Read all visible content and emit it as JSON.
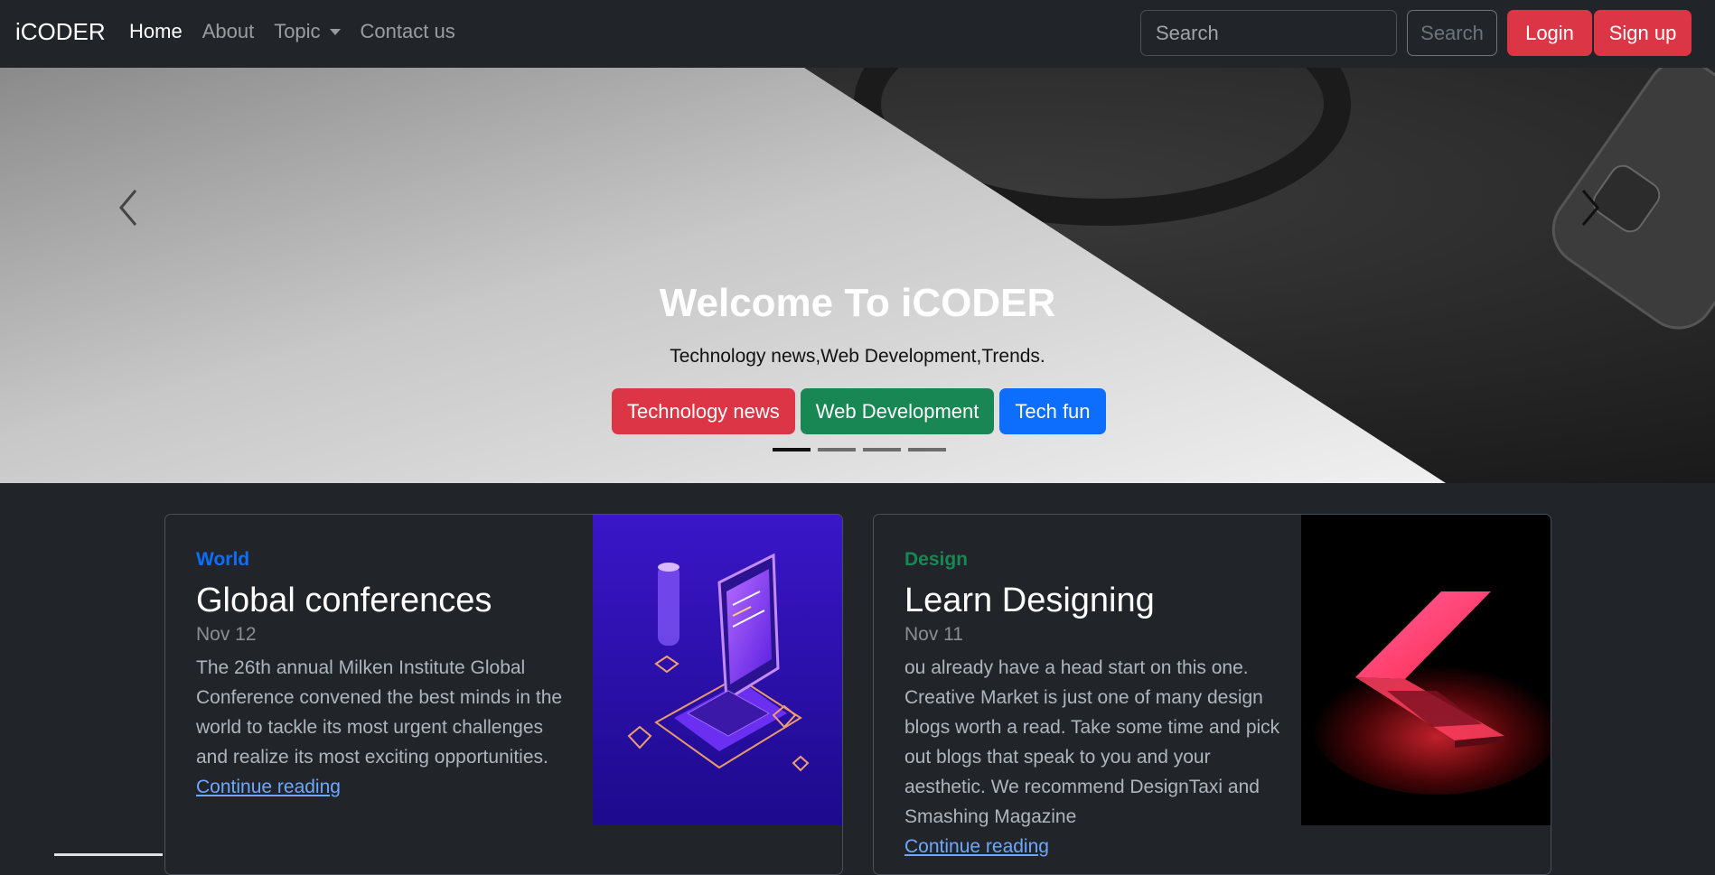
{
  "nav": {
    "brand": "iCODER",
    "links": [
      {
        "label": "Home"
      },
      {
        "label": "About"
      },
      {
        "label": "Topic"
      },
      {
        "label": "Contact us"
      }
    ],
    "search_placeholder": "Search",
    "search_button": "Search",
    "login": "Login",
    "signup": "Sign up"
  },
  "carousel": {
    "title": "Welcome To iCODER",
    "subtitle": "Technology news,Web Development,Trends.",
    "buttons": [
      {
        "label": "Technology news",
        "color": "#dc3545"
      },
      {
        "label": "Web Development",
        "color": "#198754"
      },
      {
        "label": "Tech fun",
        "color": "#0d6efd"
      }
    ],
    "slide_count": 4,
    "active_slide": 1
  },
  "cards": [
    {
      "category": "World",
      "category_color": "#0d6efd",
      "title": "Global conferences",
      "date": "Nov 12",
      "text": "The 26th annual Milken Institute Global Conference convened the best minds in the world to tackle its most urgent challenges and realize its most exciting opportunities.",
      "link": "Continue reading"
    },
    {
      "category": "Design",
      "category_color": "#198754",
      "title": "Learn Designing",
      "date": "Nov 11",
      "text": "ou already have a head start on this one. Creative Market is just one of many design blogs worth a read. Take some time and pick out blogs that speak to you and your aesthetic. We recommend DesignTaxi and Smashing Magazine",
      "link": "Continue reading"
    }
  ]
}
